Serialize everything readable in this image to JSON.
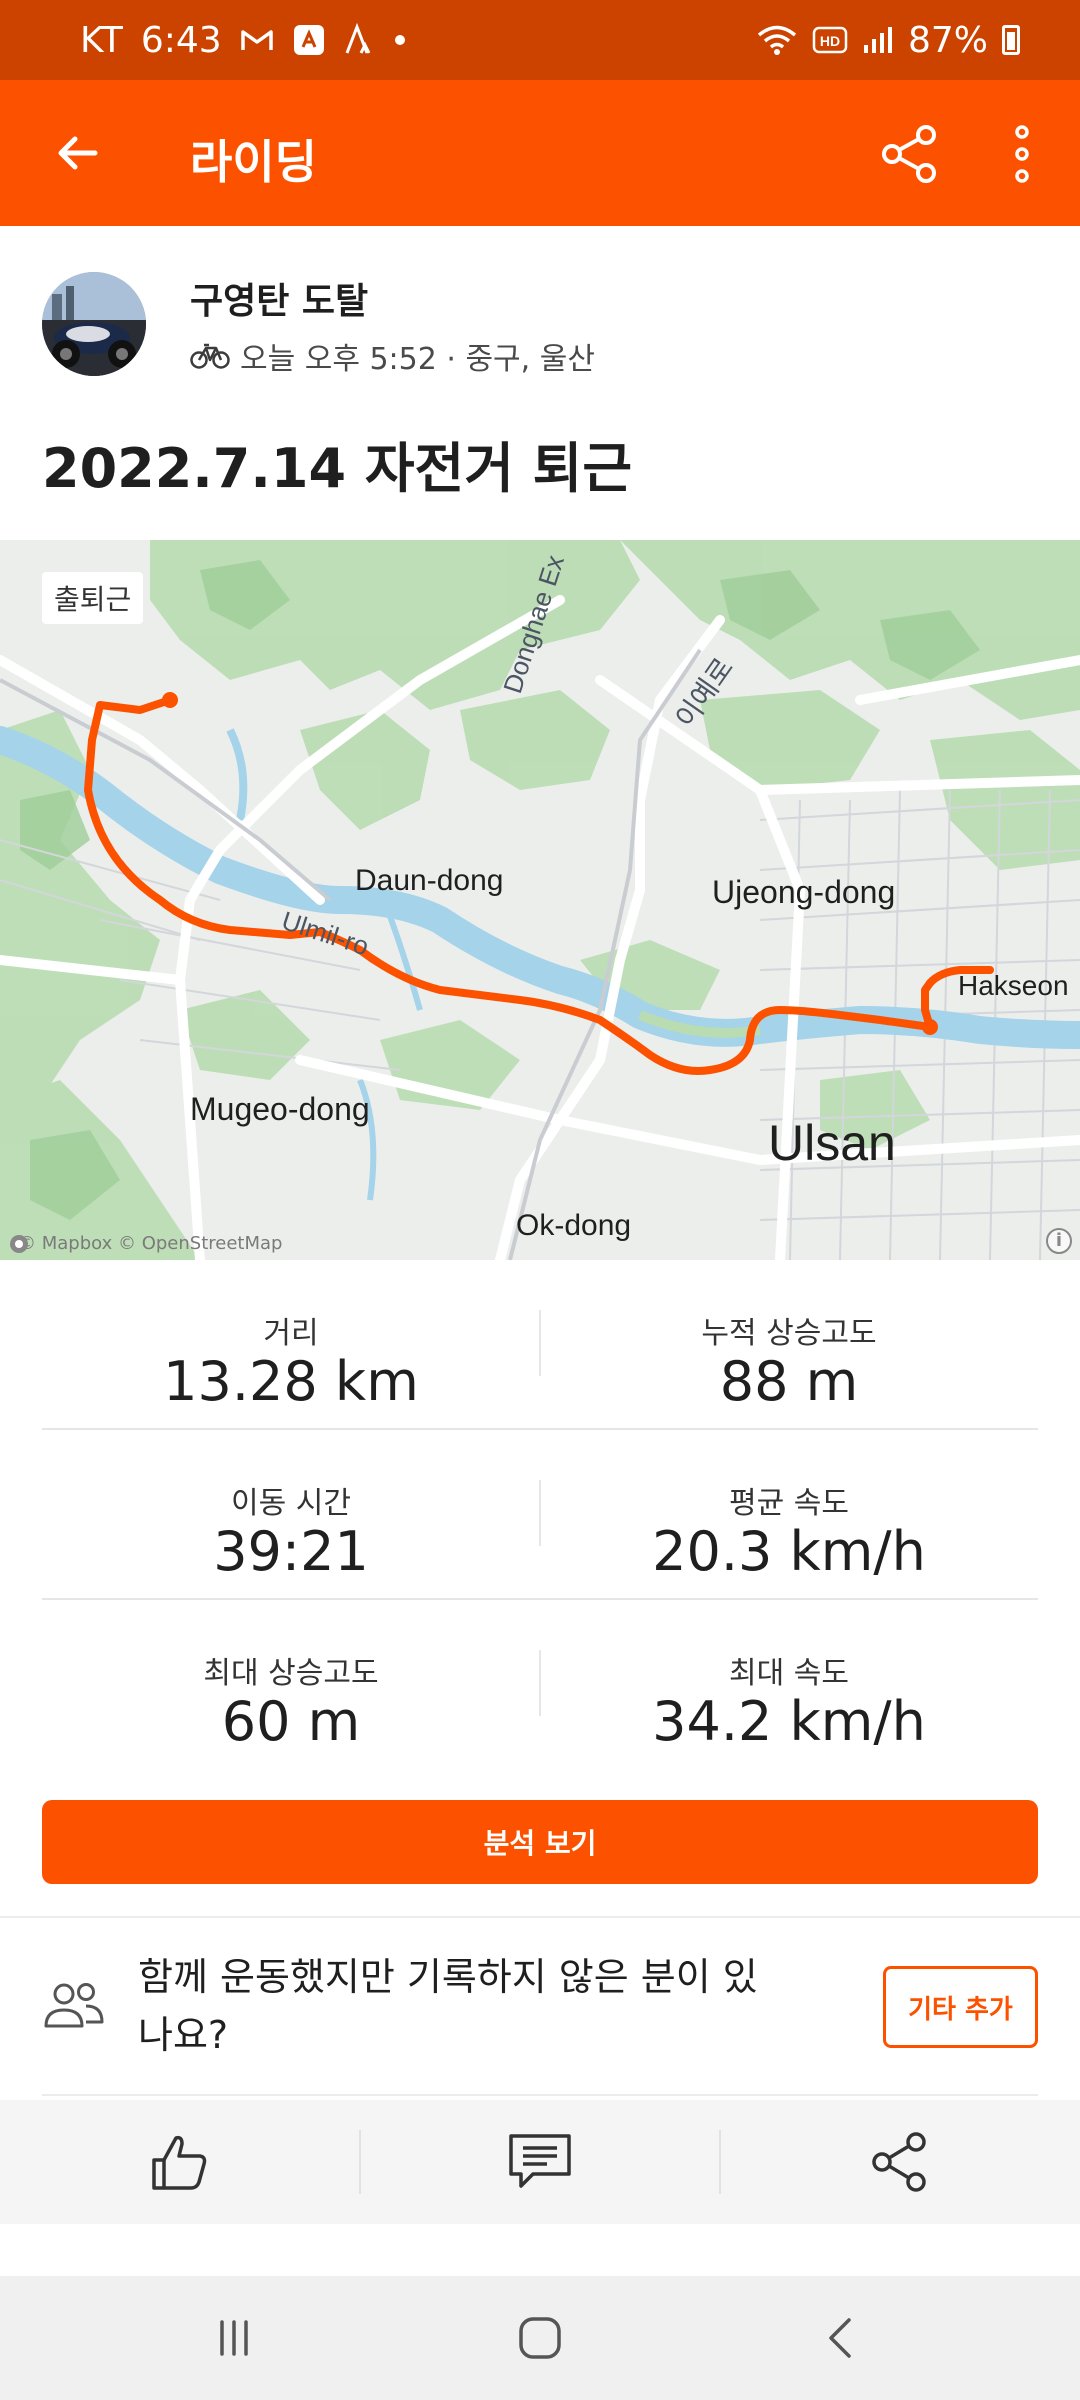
{
  "status_bar": {
    "carrier": "KT",
    "time": "6:43",
    "battery": "87%",
    "icons": [
      "gmail-icon",
      "strava-notification-icon",
      "strava-logo-icon",
      "dot-icon",
      "wifi-icon",
      "hd-voice-icon",
      "signal-icon",
      "battery-icon"
    ]
  },
  "app_bar": {
    "title": "라이딩",
    "back_icon": "arrow-left-icon",
    "share_icon": "share-icon",
    "more_icon": "more-vertical-icon"
  },
  "activity": {
    "athlete_name": "구영탄 도탈",
    "sport_icon": "bicycle-icon",
    "meta": "오늘 오후 5:52 · 중구, 울산",
    "title": "2022.7.14 자전거 퇴근"
  },
  "map": {
    "tag": "출퇴근",
    "labels": {
      "donghae": "Donghae Ex",
      "iye": "이예로",
      "daun": "Daun-dong",
      "ujeong": "Ujeong-dong",
      "ulmil": "Ulmil-ro",
      "hakseong": "Hakseon",
      "mugeo": "Mugeo-dong",
      "ulsan": "Ulsan",
      "okdong": "Ok-dong"
    },
    "attribution": "© Mapbox © OpenStreetMap",
    "route_color": "#fc5200"
  },
  "stats": {
    "distance_label": "거리",
    "distance_value": "13.28 km",
    "elev_gain_label": "누적 상승고도",
    "elev_gain_value": "88 m",
    "moving_time_label": "이동 시간",
    "moving_time_value": "39:21",
    "avg_speed_label": "평균 속도",
    "avg_speed_value": "20.3 km/h",
    "max_elev_label": "최대 상승고도",
    "max_elev_value": "60 m",
    "max_speed_label": "최대 속도",
    "max_speed_value": "34.2 km/h"
  },
  "analysis_button": "분석 보기",
  "group_prompt": {
    "text": "함께 운동했지만 기록하지 않은 분이 있나요?",
    "button": "기타 추가"
  },
  "actions": {
    "like_icon": "thumbs-up-icon",
    "comment_icon": "comment-icon",
    "share_icon": "share-icon"
  },
  "colors": {
    "brand": "#fc5200",
    "status_bar": "#cc4300"
  }
}
